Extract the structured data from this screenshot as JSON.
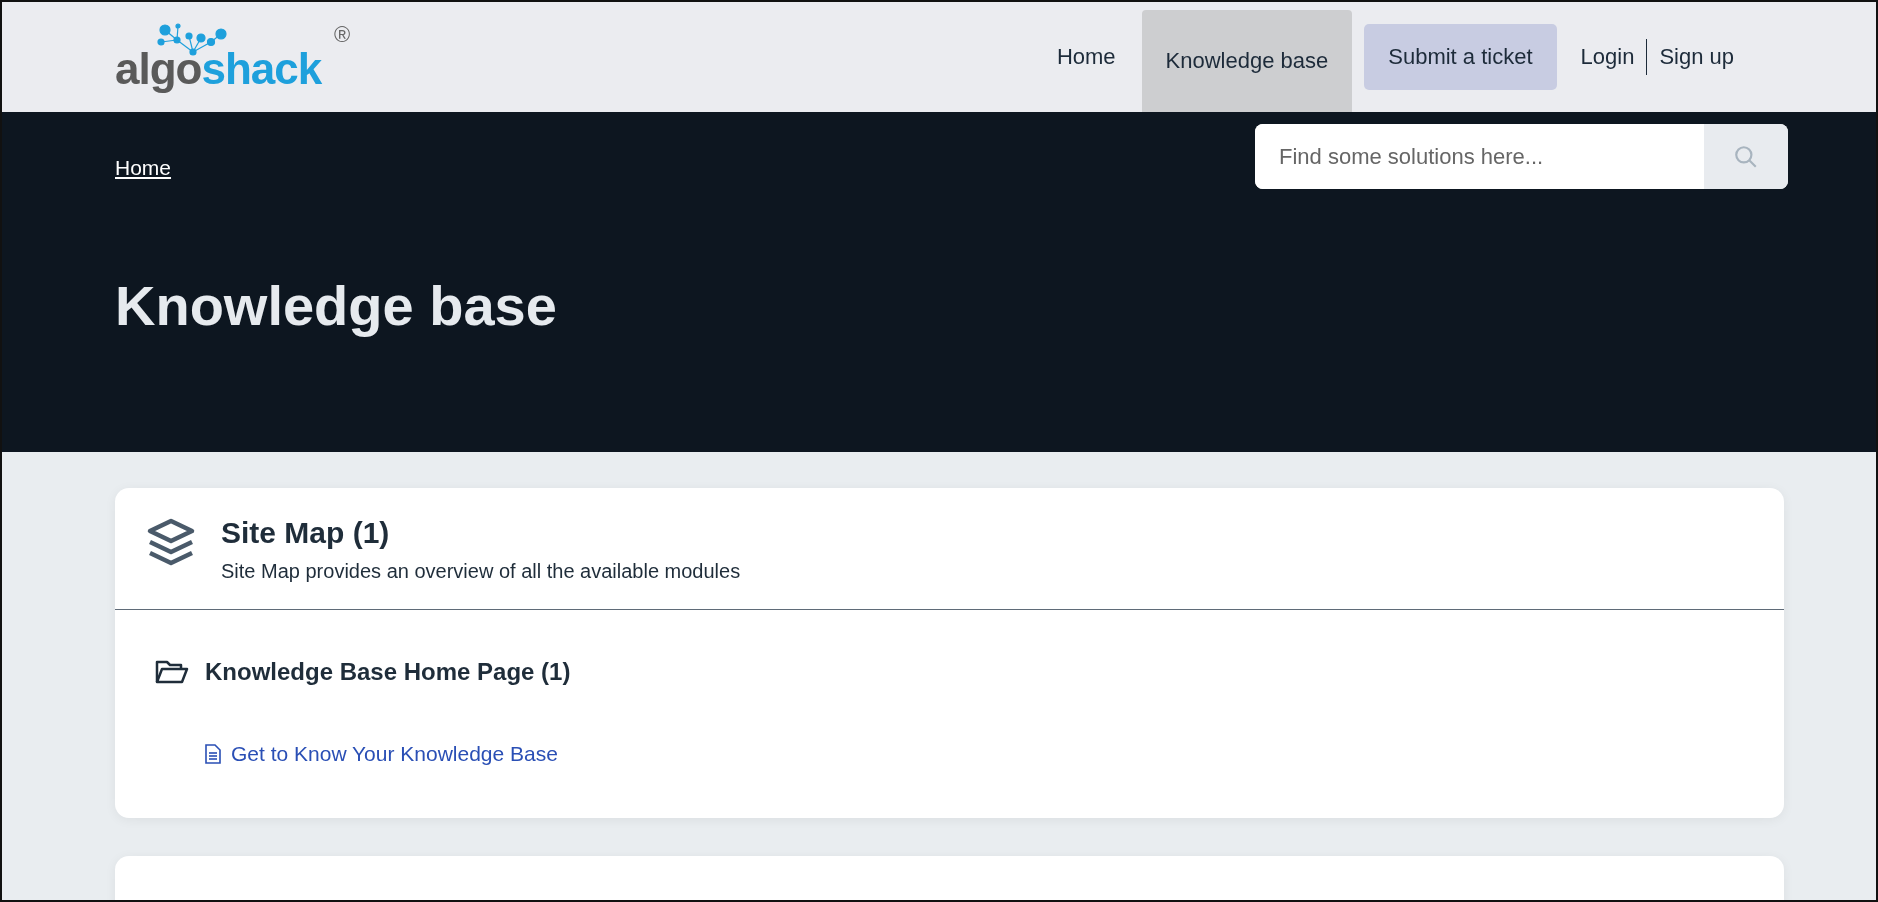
{
  "logo": {
    "dark_part": "algo",
    "light_part": "shack",
    "mark": "®"
  },
  "nav": [
    {
      "label": "Home",
      "kind": "link",
      "selected": false
    },
    {
      "label": "Knowledge base",
      "kind": "link",
      "selected": true
    },
    {
      "label": "Submit a ticket",
      "kind": "button",
      "selected": false
    },
    {
      "label": "Login",
      "kind": "auth",
      "selected": false
    },
    {
      "label": "Sign up",
      "kind": "auth",
      "selected": false
    }
  ],
  "breadcrumb": [
    "Home"
  ],
  "search": {
    "placeholder": "Find some solutions here..."
  },
  "page_title": "Knowledge base",
  "sections": [
    {
      "title": "Site Map (1)",
      "description": "Site Map provides an overview of all the available modules",
      "folders": [
        {
          "title": "Knowledge Base Home Page (1)",
          "articles": [
            "Get to Know Your Knowledge Base"
          ]
        }
      ]
    }
  ]
}
